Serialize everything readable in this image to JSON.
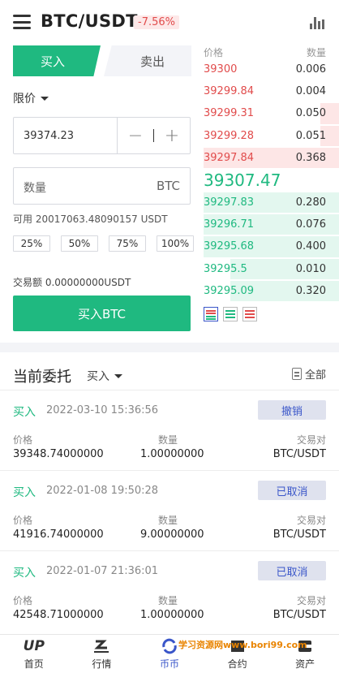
{
  "header": {
    "pair": "BTC/USDT",
    "change": "-7.56%"
  },
  "trade": {
    "tab_buy": "买入",
    "tab_sell": "卖出",
    "order_type": "限价",
    "price": "39374.23",
    "qty_placeholder": "数量",
    "qty_unit": "BTC",
    "available": "可用 20017063.48090157 USDT",
    "percents": [
      "25%",
      "50%",
      "75%",
      "100%"
    ],
    "volume": "交易额 0.00000000USDT",
    "buy_button": "买入BTC"
  },
  "book": {
    "price_header": "价格",
    "qty_header": "数量",
    "asks": [
      {
        "price": "39300",
        "qty": "0.006",
        "depth": 0.0
      },
      {
        "price": "39299.84",
        "qty": "0.004",
        "depth": 0.0
      },
      {
        "price": "39299.31",
        "qty": "0.050",
        "depth": 0.14
      },
      {
        "price": "39299.28",
        "qty": "0.051",
        "depth": 0.14
      },
      {
        "price": "39297.84",
        "qty": "0.368",
        "depth": 1.0
      }
    ],
    "last_price": "39307.47",
    "bids": [
      {
        "price": "39297.83",
        "qty": "0.280",
        "depth": 1.0
      },
      {
        "price": "39296.71",
        "qty": "0.076",
        "depth": 1.0
      },
      {
        "price": "39295.68",
        "qty": "0.400",
        "depth": 1.0
      },
      {
        "price": "39295.5",
        "qty": "0.010",
        "depth": 0.8
      },
      {
        "price": "39295.09",
        "qty": "0.320",
        "depth": 0.8
      }
    ]
  },
  "orders": {
    "title": "当前委托",
    "filter": "买入",
    "all": "全部",
    "labels": {
      "price": "价格",
      "qty": "数量",
      "pair": "交易对"
    },
    "items": [
      {
        "side": "买入",
        "time": "2022-03-10 15:36:56",
        "action": "撤销",
        "price": "39348.74000000",
        "qty": "1.00000000",
        "pair": "BTC/USDT"
      },
      {
        "side": "买入",
        "time": "2022-01-08 19:50:28",
        "action": "已取消",
        "price": "41916.74000000",
        "qty": "9.00000000",
        "pair": "BTC/USDT"
      },
      {
        "side": "买入",
        "time": "2022-01-07 21:36:01",
        "action": "已取消",
        "price": "42548.71000000",
        "qty": "1.00000000",
        "pair": "BTC/USDT"
      }
    ]
  },
  "nav": [
    {
      "label": "首页",
      "icon": "home-up-icon"
    },
    {
      "label": "行情",
      "icon": "market-icon"
    },
    {
      "label": "币币",
      "icon": "spot-trade-icon"
    },
    {
      "label": "合约",
      "icon": "contract-icon"
    },
    {
      "label": "资产",
      "icon": "assets-icon"
    }
  ],
  "watermark": "学习资源网www.bori99.com",
  "colors": {
    "green": "#1fb980",
    "red": "#e14b4b",
    "blue": "#3a56c9"
  }
}
